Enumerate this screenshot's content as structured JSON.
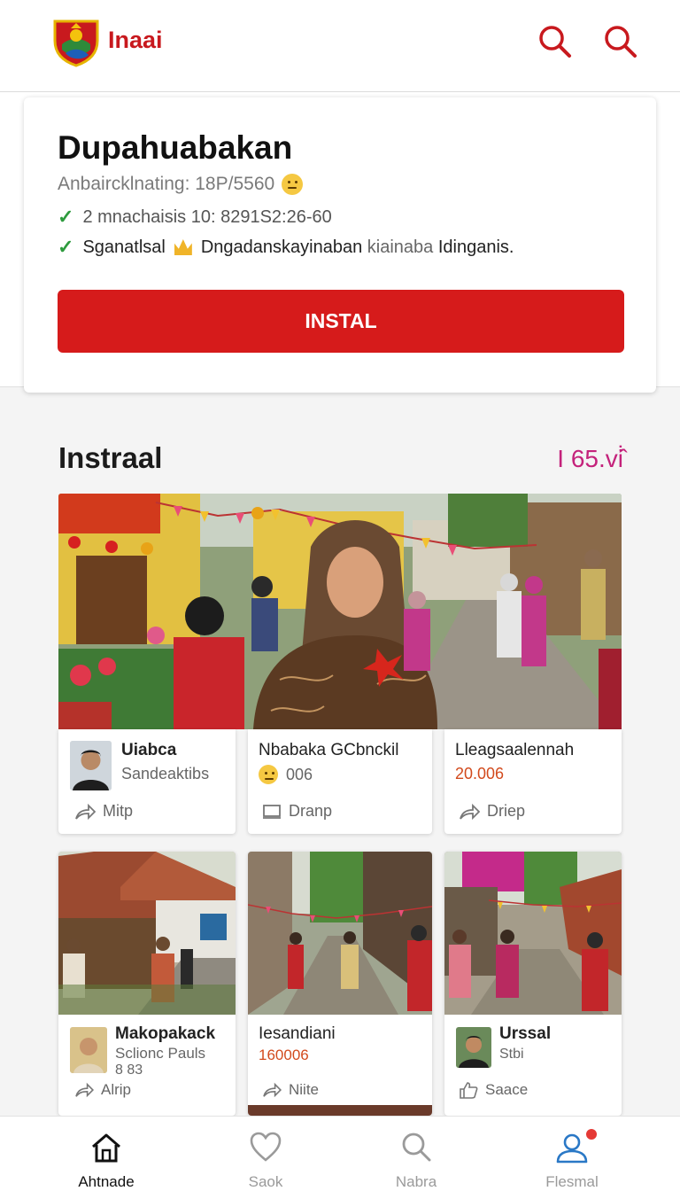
{
  "header": {
    "brand": "Inaai",
    "icons": [
      "shield-logo",
      "search-icon",
      "search-icon"
    ]
  },
  "app_card": {
    "title": "Dupahuabakan",
    "subtitle": "Anbaircklnating: 18P/5560",
    "row1": "2 mnachaisis 10: 8291S2:26-60",
    "row2_main": "Sganatlsal",
    "row2_mid": "Dngadanskayinaban",
    "row2_muted": "kiainaba",
    "row2_end": "Idinganis.",
    "install_label": "INSTAL"
  },
  "section": {
    "title": "Instraal",
    "count": "I 65.vi̇̂"
  },
  "tiles_row1": [
    {
      "name": "Uiabca",
      "sub": "Sandeaktibs",
      "action": "Mitp"
    },
    {
      "name": "Nbabaka GCbnckil",
      "sub": "006",
      "action": "Dranp"
    },
    {
      "name": "Lleagsaalennah",
      "sub": "20.006",
      "action": "Driep"
    }
  ],
  "tiles_row2": [
    {
      "name": "Makopakack",
      "sub": "Sclionc Pauls",
      "sub2": "8 83",
      "action": "Alrip"
    },
    {
      "name": "Iesandiani",
      "sub": "160006",
      "action": "Niite"
    },
    {
      "name": "Urssal",
      "sub": "Stbi",
      "action": "Saace"
    }
  ],
  "bottom_nav": [
    {
      "label": "Ahtnade",
      "icon": "home-icon",
      "active": true
    },
    {
      "label": "Saok",
      "icon": "heart-icon",
      "active": false
    },
    {
      "label": "Nabra",
      "icon": "search-icon",
      "active": false
    },
    {
      "label": "Flesmal",
      "icon": "profile-icon",
      "active": false
    }
  ],
  "colors": {
    "accent": "#d61b1b",
    "brand": "#c8191e",
    "count": "#c4227b",
    "check": "#2e9b3e",
    "number": "#d24a1d"
  }
}
